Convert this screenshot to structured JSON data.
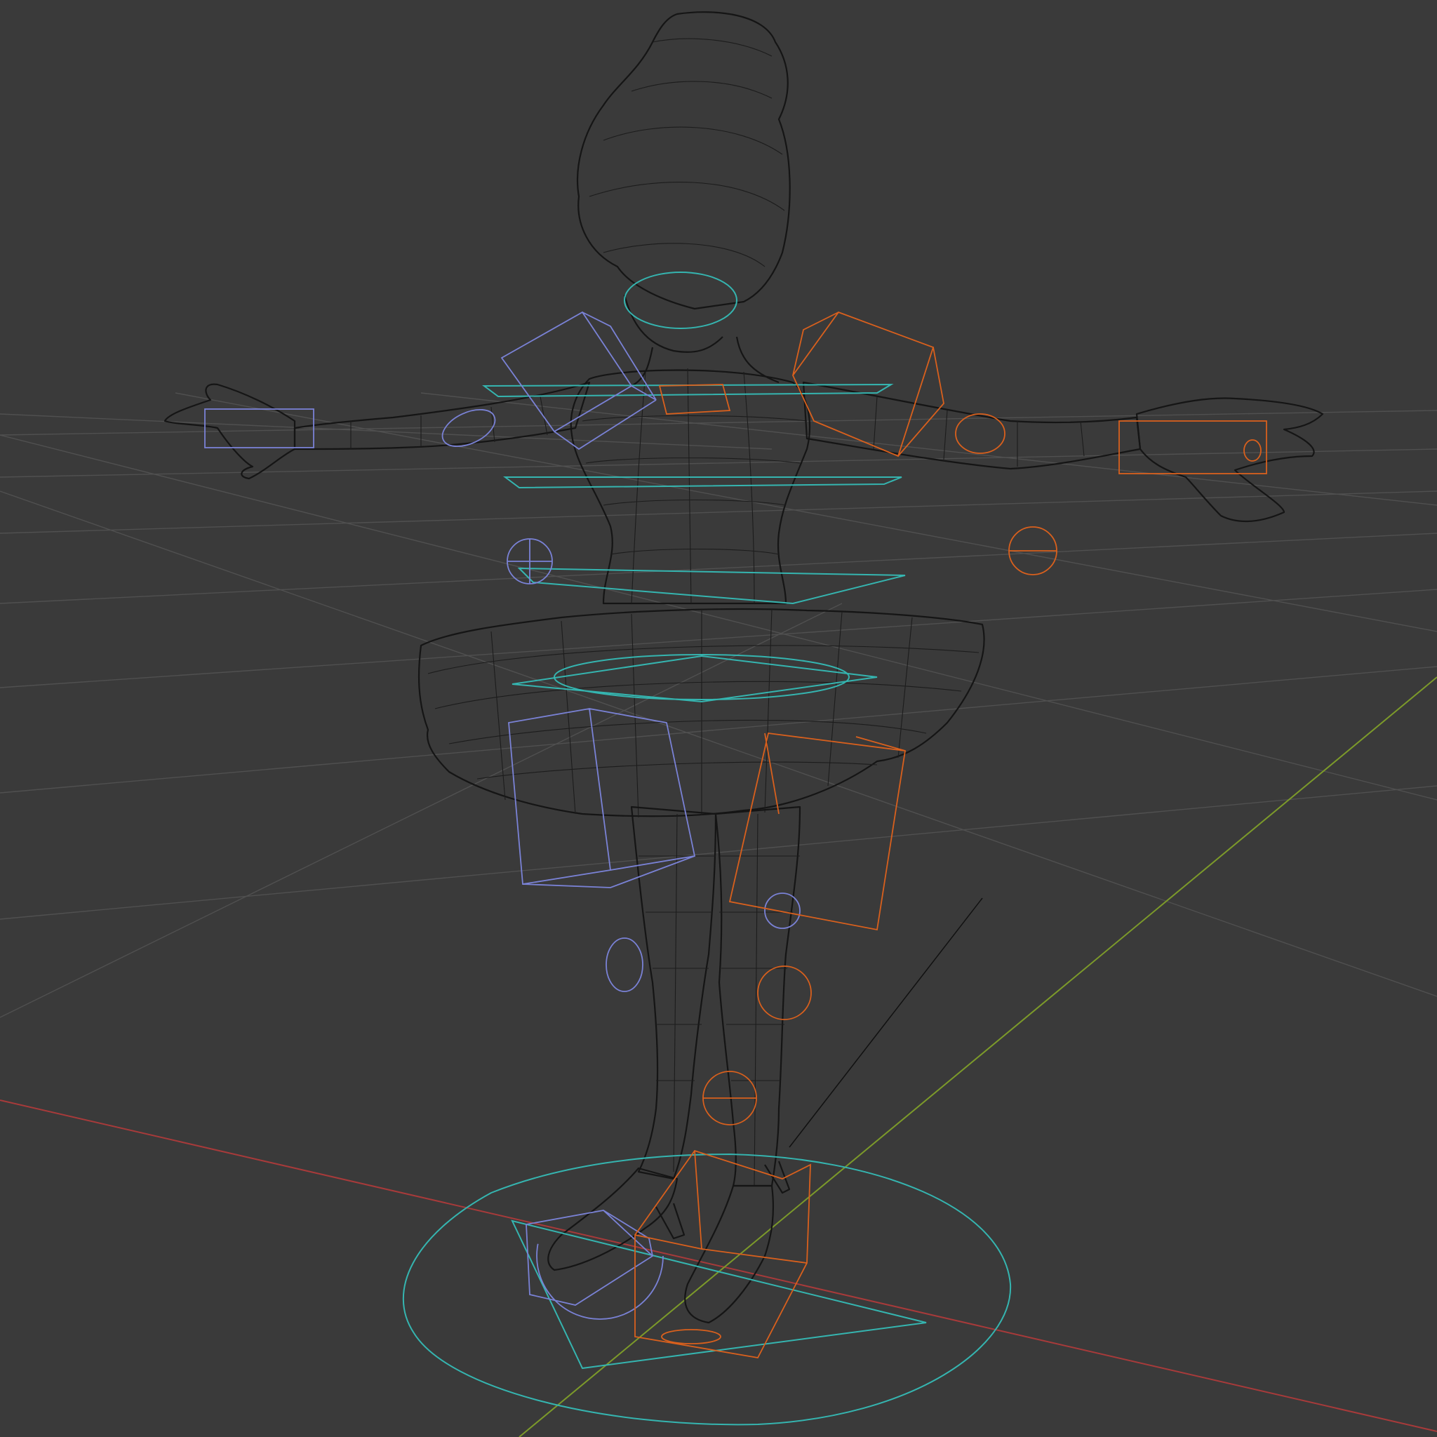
{
  "viewport": {
    "background": "#3a3a3a",
    "grid_color": "#505050",
    "x_axis_color": "#a83a3a",
    "y_axis_color": "#7c9a2a",
    "mesh_color": "#151515"
  },
  "controls": {
    "center_color": "#35b5b0",
    "left_color": "#7a82d6",
    "right_color": "#d9601d"
  }
}
